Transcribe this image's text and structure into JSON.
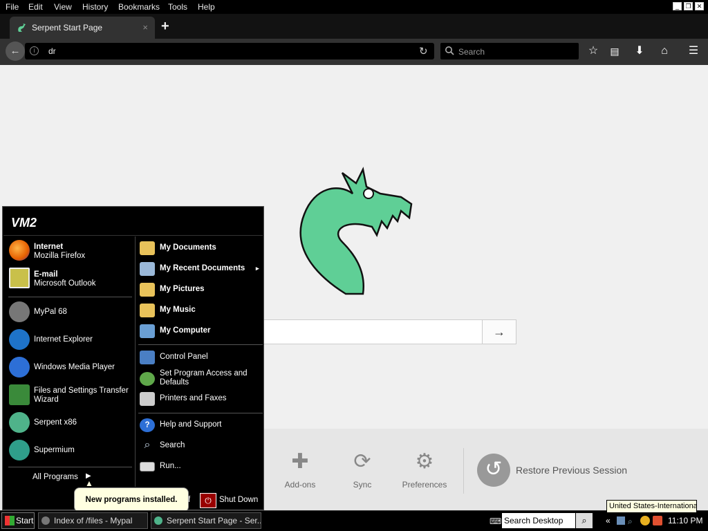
{
  "menubar": {
    "items": [
      "File",
      "Edit",
      "View",
      "History",
      "Bookmarks",
      "Tools",
      "Help"
    ]
  },
  "tab": {
    "title": "Serpent Start Page",
    "close": "×"
  },
  "newtab": "+",
  "url": {
    "value": "dr"
  },
  "search": {
    "placeholder": "Search"
  },
  "search_go": "→",
  "launchers": [
    {
      "label": "Add-ons",
      "icon": "puzzle-icon"
    },
    {
      "label": "Sync",
      "icon": "sync-icon"
    },
    {
      "label": "Preferences",
      "icon": "gear-icon"
    }
  ],
  "restore_session": "Restore Previous Session",
  "startmenu": {
    "user": "VM2",
    "pinned": [
      {
        "title": "Internet",
        "subtitle": "Mozilla Firefox",
        "icon": "firefox-icon",
        "color": "#e66000"
      },
      {
        "title": "E-mail",
        "subtitle": "Microsoft Outlook",
        "icon": "outlook-icon",
        "color": "#c9c04a"
      }
    ],
    "recent": [
      {
        "label": "MyPal 68",
        "icon": "mypal-icon",
        "color": "#777777"
      },
      {
        "label": "Internet Explorer",
        "icon": "ie-icon",
        "color": "#1e73c9"
      },
      {
        "label": "Windows Media Player",
        "icon": "wmp-icon",
        "color": "#2d6fd6"
      },
      {
        "label": "Files and Settings Transfer Wizard",
        "icon": "transfer-wizard-icon",
        "color": "#3a8a3a"
      },
      {
        "label": "Serpent x86",
        "icon": "serpent-icon",
        "color": "#4fb38a"
      },
      {
        "label": "Supermium",
        "icon": "supermium-icon",
        "color": "#2f9e8a"
      }
    ],
    "all_programs": "All Programs",
    "right": [
      {
        "label": "My Documents",
        "bold": true,
        "icon": "folder-documents-icon"
      },
      {
        "label": "My Recent Documents",
        "bold": true,
        "icon": "recent-documents-icon",
        "arrow": "▸"
      },
      {
        "label": "My Pictures",
        "bold": true,
        "icon": "folder-pictures-icon"
      },
      {
        "label": "My Music",
        "bold": true,
        "icon": "folder-music-icon"
      },
      {
        "label": "My Computer",
        "bold": true,
        "icon": "computer-icon"
      },
      {
        "label": "Control Panel",
        "bold": false,
        "icon": "control-panel-icon"
      },
      {
        "label": "Set Program Access and Defaults",
        "bold": false,
        "icon": "program-defaults-icon"
      },
      {
        "label": "Printers and Faxes",
        "bold": false,
        "icon": "printer-icon"
      },
      {
        "label": "Help and Support",
        "bold": false,
        "icon": "help-icon"
      },
      {
        "label": "Search",
        "bold": false,
        "icon": "search-icon"
      },
      {
        "label": "Run...",
        "bold": false,
        "icon": "run-icon"
      }
    ],
    "logoff_fragment": "f",
    "shutdown": "Shut Down"
  },
  "balloon": "New programs installed.",
  "taskbar": {
    "start": "Start",
    "buttons": [
      {
        "label": "Index of /files - Mypal",
        "icon": "mypal-icon"
      },
      {
        "label": "Serpent Start Page - Ser...",
        "icon": "serpent-icon"
      }
    ],
    "search_value": "Search Desktop",
    "tray_chevron": "«",
    "clock": "11:10 PM",
    "language_tooltip": "United States-International"
  },
  "colors": {
    "serpent_green": "#5fcf96",
    "dark_chrome": "#323232"
  }
}
